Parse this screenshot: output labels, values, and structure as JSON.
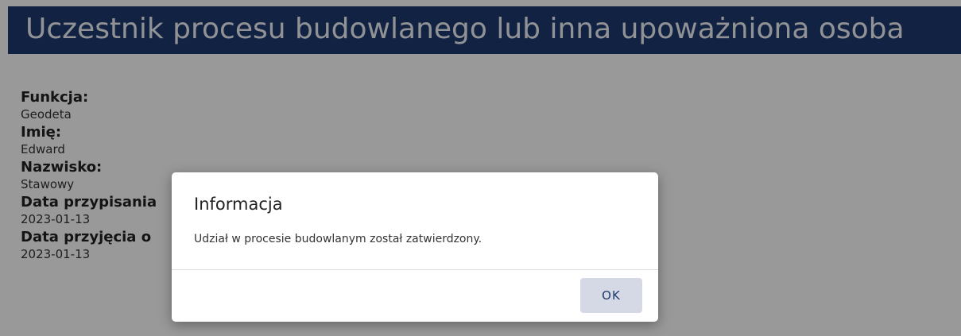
{
  "header": {
    "title": "Uczestnik procesu budowlanego lub inna upoważniona osoba"
  },
  "details": {
    "fields": [
      {
        "label": "Funkcja:",
        "value": "Geodeta"
      },
      {
        "label": "Imię:",
        "value": "Edward"
      },
      {
        "label": "Nazwisko:",
        "value": "Stawowy"
      },
      {
        "label": "Data przypisania",
        "value": "2023-01-13"
      },
      {
        "label": "Data przyjęcia o",
        "value": "2023-01-13"
      }
    ]
  },
  "dialog": {
    "title": "Informacja",
    "message": "Udział w procesie budowlanym został zatwierdzony.",
    "ok_label": "OK"
  },
  "colors": {
    "header_background": "#1e3a6e",
    "overlay": "rgba(0,0,0,0.4)",
    "button_background": "#d5d9e5",
    "button_text": "#1e3a6e"
  }
}
